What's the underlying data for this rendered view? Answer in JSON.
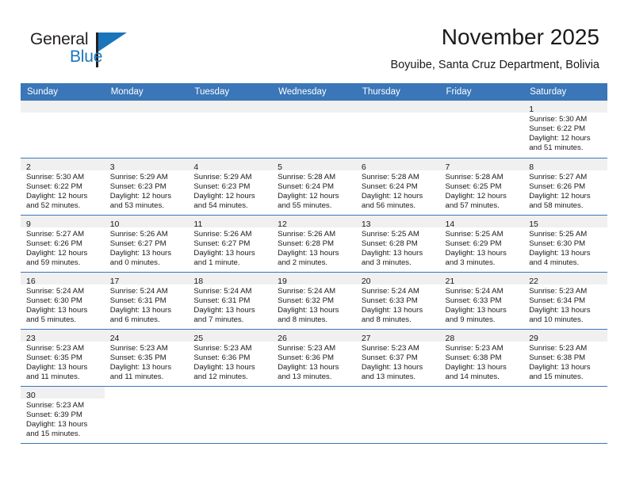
{
  "logo": {
    "word_one": "General",
    "word_two": "Blue",
    "accent_color": "#1b75bb",
    "text_color": "#231f20"
  },
  "header": {
    "title": "November 2025",
    "subtitle": "Boyuibe, Santa Cruz Department, Bolivia"
  },
  "calendar": {
    "header_color": "#3a76b8",
    "weekdays": [
      "Sunday",
      "Monday",
      "Tuesday",
      "Wednesday",
      "Thursday",
      "Friday",
      "Saturday"
    ],
    "weeks": [
      [
        {
          "empty": true
        },
        {
          "empty": true
        },
        {
          "empty": true
        },
        {
          "empty": true
        },
        {
          "empty": true
        },
        {
          "empty": true
        },
        {
          "day": "1",
          "sunrise": "Sunrise: 5:30 AM",
          "sunset": "Sunset: 6:22 PM",
          "daylight_1": "Daylight: 12 hours",
          "daylight_2": "and 51 minutes."
        }
      ],
      [
        {
          "day": "2",
          "sunrise": "Sunrise: 5:30 AM",
          "sunset": "Sunset: 6:22 PM",
          "daylight_1": "Daylight: 12 hours",
          "daylight_2": "and 52 minutes."
        },
        {
          "day": "3",
          "sunrise": "Sunrise: 5:29 AM",
          "sunset": "Sunset: 6:23 PM",
          "daylight_1": "Daylight: 12 hours",
          "daylight_2": "and 53 minutes."
        },
        {
          "day": "4",
          "sunrise": "Sunrise: 5:29 AM",
          "sunset": "Sunset: 6:23 PM",
          "daylight_1": "Daylight: 12 hours",
          "daylight_2": "and 54 minutes."
        },
        {
          "day": "5",
          "sunrise": "Sunrise: 5:28 AM",
          "sunset": "Sunset: 6:24 PM",
          "daylight_1": "Daylight: 12 hours",
          "daylight_2": "and 55 minutes."
        },
        {
          "day": "6",
          "sunrise": "Sunrise: 5:28 AM",
          "sunset": "Sunset: 6:24 PM",
          "daylight_1": "Daylight: 12 hours",
          "daylight_2": "and 56 minutes."
        },
        {
          "day": "7",
          "sunrise": "Sunrise: 5:28 AM",
          "sunset": "Sunset: 6:25 PM",
          "daylight_1": "Daylight: 12 hours",
          "daylight_2": "and 57 minutes."
        },
        {
          "day": "8",
          "sunrise": "Sunrise: 5:27 AM",
          "sunset": "Sunset: 6:26 PM",
          "daylight_1": "Daylight: 12 hours",
          "daylight_2": "and 58 minutes."
        }
      ],
      [
        {
          "day": "9",
          "sunrise": "Sunrise: 5:27 AM",
          "sunset": "Sunset: 6:26 PM",
          "daylight_1": "Daylight: 12 hours",
          "daylight_2": "and 59 minutes."
        },
        {
          "day": "10",
          "sunrise": "Sunrise: 5:26 AM",
          "sunset": "Sunset: 6:27 PM",
          "daylight_1": "Daylight: 13 hours",
          "daylight_2": "and 0 minutes."
        },
        {
          "day": "11",
          "sunrise": "Sunrise: 5:26 AM",
          "sunset": "Sunset: 6:27 PM",
          "daylight_1": "Daylight: 13 hours",
          "daylight_2": "and 1 minute."
        },
        {
          "day": "12",
          "sunrise": "Sunrise: 5:26 AM",
          "sunset": "Sunset: 6:28 PM",
          "daylight_1": "Daylight: 13 hours",
          "daylight_2": "and 2 minutes."
        },
        {
          "day": "13",
          "sunrise": "Sunrise: 5:25 AM",
          "sunset": "Sunset: 6:28 PM",
          "daylight_1": "Daylight: 13 hours",
          "daylight_2": "and 3 minutes."
        },
        {
          "day": "14",
          "sunrise": "Sunrise: 5:25 AM",
          "sunset": "Sunset: 6:29 PM",
          "daylight_1": "Daylight: 13 hours",
          "daylight_2": "and 3 minutes."
        },
        {
          "day": "15",
          "sunrise": "Sunrise: 5:25 AM",
          "sunset": "Sunset: 6:30 PM",
          "daylight_1": "Daylight: 13 hours",
          "daylight_2": "and 4 minutes."
        }
      ],
      [
        {
          "day": "16",
          "sunrise": "Sunrise: 5:24 AM",
          "sunset": "Sunset: 6:30 PM",
          "daylight_1": "Daylight: 13 hours",
          "daylight_2": "and 5 minutes."
        },
        {
          "day": "17",
          "sunrise": "Sunrise: 5:24 AM",
          "sunset": "Sunset: 6:31 PM",
          "daylight_1": "Daylight: 13 hours",
          "daylight_2": "and 6 minutes."
        },
        {
          "day": "18",
          "sunrise": "Sunrise: 5:24 AM",
          "sunset": "Sunset: 6:31 PM",
          "daylight_1": "Daylight: 13 hours",
          "daylight_2": "and 7 minutes."
        },
        {
          "day": "19",
          "sunrise": "Sunrise: 5:24 AM",
          "sunset": "Sunset: 6:32 PM",
          "daylight_1": "Daylight: 13 hours",
          "daylight_2": "and 8 minutes."
        },
        {
          "day": "20",
          "sunrise": "Sunrise: 5:24 AM",
          "sunset": "Sunset: 6:33 PM",
          "daylight_1": "Daylight: 13 hours",
          "daylight_2": "and 8 minutes."
        },
        {
          "day": "21",
          "sunrise": "Sunrise: 5:24 AM",
          "sunset": "Sunset: 6:33 PM",
          "daylight_1": "Daylight: 13 hours",
          "daylight_2": "and 9 minutes."
        },
        {
          "day": "22",
          "sunrise": "Sunrise: 5:23 AM",
          "sunset": "Sunset: 6:34 PM",
          "daylight_1": "Daylight: 13 hours",
          "daylight_2": "and 10 minutes."
        }
      ],
      [
        {
          "day": "23",
          "sunrise": "Sunrise: 5:23 AM",
          "sunset": "Sunset: 6:35 PM",
          "daylight_1": "Daylight: 13 hours",
          "daylight_2": "and 11 minutes."
        },
        {
          "day": "24",
          "sunrise": "Sunrise: 5:23 AM",
          "sunset": "Sunset: 6:35 PM",
          "daylight_1": "Daylight: 13 hours",
          "daylight_2": "and 11 minutes."
        },
        {
          "day": "25",
          "sunrise": "Sunrise: 5:23 AM",
          "sunset": "Sunset: 6:36 PM",
          "daylight_1": "Daylight: 13 hours",
          "daylight_2": "and 12 minutes."
        },
        {
          "day": "26",
          "sunrise": "Sunrise: 5:23 AM",
          "sunset": "Sunset: 6:36 PM",
          "daylight_1": "Daylight: 13 hours",
          "daylight_2": "and 13 minutes."
        },
        {
          "day": "27",
          "sunrise": "Sunrise: 5:23 AM",
          "sunset": "Sunset: 6:37 PM",
          "daylight_1": "Daylight: 13 hours",
          "daylight_2": "and 13 minutes."
        },
        {
          "day": "28",
          "sunrise": "Sunrise: 5:23 AM",
          "sunset": "Sunset: 6:38 PM",
          "daylight_1": "Daylight: 13 hours",
          "daylight_2": "and 14 minutes."
        },
        {
          "day": "29",
          "sunrise": "Sunrise: 5:23 AM",
          "sunset": "Sunset: 6:38 PM",
          "daylight_1": "Daylight: 13 hours",
          "daylight_2": "and 15 minutes."
        }
      ],
      [
        {
          "day": "30",
          "sunrise": "Sunrise: 5:23 AM",
          "sunset": "Sunset: 6:39 PM",
          "daylight_1": "Daylight: 13 hours",
          "daylight_2": "and 15 minutes."
        },
        {
          "blank": true
        },
        {
          "blank": true
        },
        {
          "blank": true
        },
        {
          "blank": true
        },
        {
          "blank": true
        },
        {
          "blank": true
        }
      ]
    ]
  }
}
